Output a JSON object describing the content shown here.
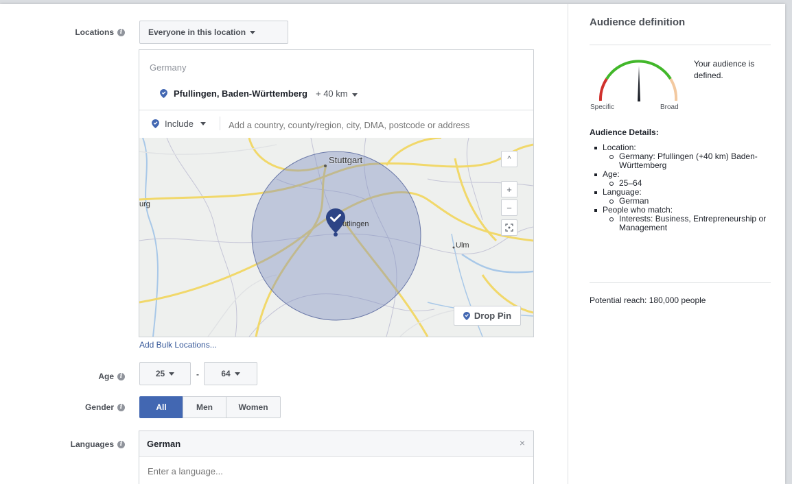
{
  "locations": {
    "label": "Locations",
    "dropdown": "Everyone in this location",
    "country": "Germany",
    "city": "Pfullingen, Baden-Württemberg",
    "radius": "+ 40 km",
    "include": "Include",
    "search_placeholder": "Add a country, county/region, city, DMA, postcode or address",
    "bulk_link": "Add Bulk Locations..."
  },
  "map": {
    "labels": {
      "stuttgart": "Stuttgart",
      "reutlingen": "utlingen",
      "ulm": "Ulm",
      "left_city": "urg"
    },
    "drop_pin": "Drop Pin",
    "controls": {
      "up": "^",
      "zoom_in": "+",
      "zoom_out": "−"
    }
  },
  "age": {
    "label": "Age",
    "min": "25",
    "separator": "-",
    "max": "64"
  },
  "gender": {
    "label": "Gender",
    "options": [
      "All",
      "Men",
      "Women"
    ],
    "selected": "All"
  },
  "languages": {
    "label": "Languages",
    "selected": "German",
    "remove": "×",
    "placeholder": "Enter a language..."
  },
  "sidebar": {
    "title": "Audience definition",
    "gauge": {
      "left_label": "Specific",
      "right_label": "Broad",
      "status": "Your audience is defined."
    },
    "details_title": "Audience Details:",
    "details": [
      {
        "label": "Location:",
        "values": [
          "Germany: Pfullingen (+40 km) Baden-Württemberg"
        ]
      },
      {
        "label": "Age:",
        "values": [
          "25–64"
        ]
      },
      {
        "label": "Language:",
        "values": [
          "German"
        ]
      },
      {
        "label": "People who match:",
        "values": [
          "Interests: Business, Entrepreneurship or Management"
        ]
      }
    ],
    "potential_reach": "Potential reach: 180,000 people"
  },
  "colors": {
    "accent": "#4267b2",
    "pin": "#2d4486",
    "gauge_green": "#42b72a",
    "gauge_red": "#d0312d",
    "gauge_peach": "#f3c9a0"
  }
}
